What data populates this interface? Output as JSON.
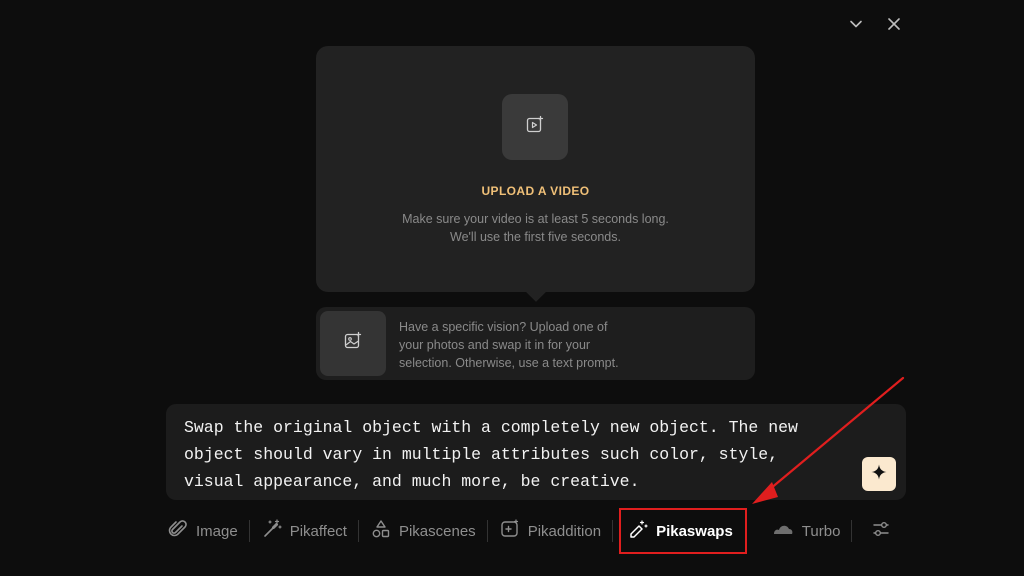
{
  "window": {
    "controls": [
      {
        "name": "chevron-down-icon"
      },
      {
        "name": "close-icon"
      }
    ]
  },
  "upload": {
    "title": "UPLOAD A VIDEO",
    "line1": "Make sure your video is at least 5 seconds long.",
    "line2": "We'll use the first five seconds.",
    "icon": "video-upload-icon"
  },
  "swap_hint": {
    "line1": "Have a specific vision? Upload one of",
    "line2": "your photos and swap it in for your",
    "line3": "selection. Otherwise, use a text prompt.",
    "icon": "image-upload-icon"
  },
  "prompt": {
    "line1": "Swap the original object with a completely new object. The new",
    "line2": "object should vary in multiple attributes such color, style,",
    "line3": "visual appearance, and much more, be creative.",
    "enhance_icon": "sparkle-icon"
  },
  "toolbar": {
    "items": [
      {
        "label": "Image",
        "icon": "paperclip-icon"
      },
      {
        "label": "Pikaffect",
        "icon": "magic-wand-icon"
      },
      {
        "label": "Pikascenes",
        "icon": "shapes-icon"
      },
      {
        "label": "Pikaddition",
        "icon": "add-video-icon"
      },
      {
        "label": "Pikaswaps",
        "icon": "swap-wand-icon",
        "active": true
      },
      {
        "label": "Turbo",
        "icon": "cloud-icon"
      }
    ],
    "settings_icon": "sliders-icon"
  },
  "annotation": {
    "highlight_color": "#e01e1e",
    "arrow_color": "#e01e1e"
  },
  "colors": {
    "accent": "#f0c078",
    "background": "#0d0d0d",
    "card": "#222222"
  }
}
